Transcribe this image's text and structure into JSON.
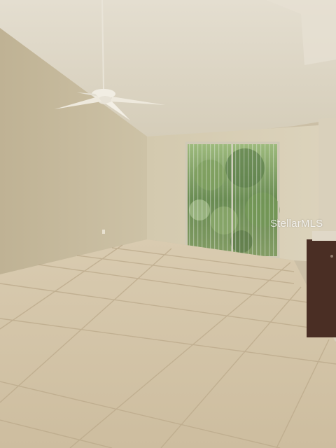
{
  "photo": {
    "subject": "empty-room-interior",
    "watermark_text": "StellarMLS"
  },
  "colors": {
    "ceiling": "#dcd6c6",
    "left_wall": "#c9bd9f",
    "back_wall": "#d6ccb2",
    "floor": "#d3c3a6",
    "grout": "#b9a88a",
    "foliage": "#4f7a36",
    "blinds": "#c8c6bc",
    "cabinet": "#4a2e24"
  },
  "icons": {
    "ceiling_fan": "ceiling-fan-icon",
    "sliding_door": "sliding-door-icon"
  }
}
